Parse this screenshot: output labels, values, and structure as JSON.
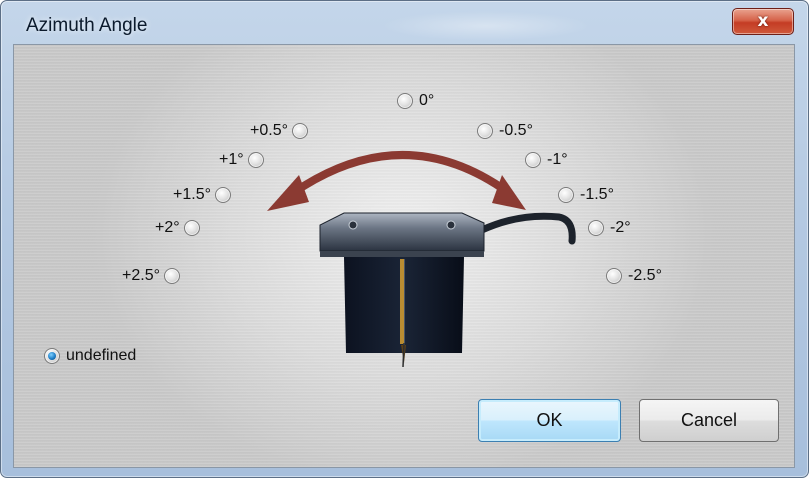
{
  "window": {
    "title": "Azimuth Angle",
    "close_label": "x"
  },
  "angles": {
    "left": [
      {
        "label": "+0.5°",
        "selected": false
      },
      {
        "label": "+1°",
        "selected": false
      },
      {
        "label": "+1.5°",
        "selected": false
      },
      {
        "label": "+2°",
        "selected": false
      },
      {
        "label": "+2.5°",
        "selected": false
      }
    ],
    "center": {
      "label": "0°",
      "selected": false
    },
    "right": [
      {
        "label": "-0.5°",
        "selected": false
      },
      {
        "label": "-1°",
        "selected": false
      },
      {
        "label": "-1.5°",
        "selected": false
      },
      {
        "label": "-2°",
        "selected": false
      },
      {
        "label": "-2.5°",
        "selected": false
      }
    ],
    "undefined": {
      "label": "undefined",
      "selected": true
    }
  },
  "buttons": {
    "ok_label": "OK",
    "cancel_label": "Cancel"
  },
  "colors": {
    "arrow": "#8b3a32",
    "radio_selected": "#1f7fc8",
    "default_button": "#3c7fb1"
  },
  "icons": {
    "close": "close-icon",
    "arrow": "double-headed-curved-arrow-icon",
    "cartridge": "phono-cartridge-image"
  }
}
